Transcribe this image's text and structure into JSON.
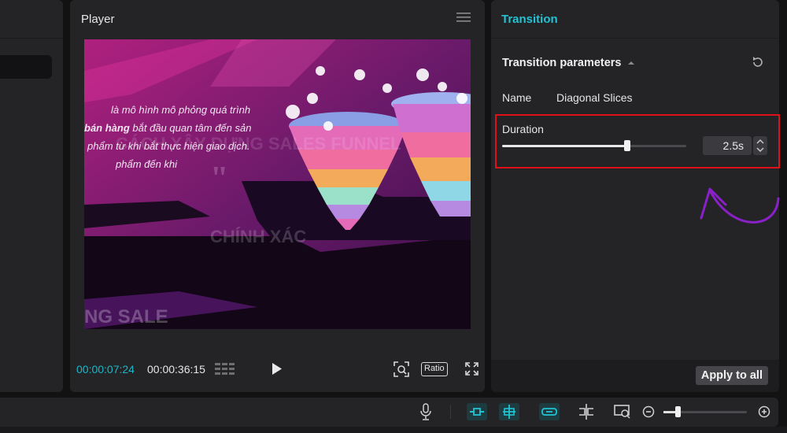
{
  "player": {
    "title": "Player",
    "current_time": "00:00:07:24",
    "total_time": "00:00:36:15",
    "ratio_label": "Ratio",
    "video_text": {
      "line1": "là mô hình mô phỏng quá trình",
      "line2_bold": "bán hàng",
      "line2_rest": "bắt đầu quan tâm đến sản",
      "line3": "phẩm từ khi bắt thực hiện giao dịch.",
      "line4": "phẩm đến khi"
    }
  },
  "transition": {
    "header": "Transition",
    "params_title": "Transition parameters",
    "name_label": "Name",
    "name_value": "Diagonal Slices",
    "duration_label": "Duration",
    "duration_value": "2.5s",
    "duration_level": 0.68,
    "apply_label": "Apply to all"
  },
  "toolbar": {
    "zoom_level": 0.17
  },
  "colors": {
    "accent": "#22c3d3",
    "highlight": "#e0101a",
    "annotation": "#8a20c8",
    "video_bg": "#5a1560"
  },
  "icons": [
    "menu-icon",
    "play-icon",
    "fullscreen-icon",
    "focus-icon",
    "grid-icon",
    "reset-icon",
    "chevron-up-down-icon",
    "microphone-icon",
    "split-icon",
    "zoom-in-icon",
    "zoom-out-icon",
    "preview-icon"
  ]
}
